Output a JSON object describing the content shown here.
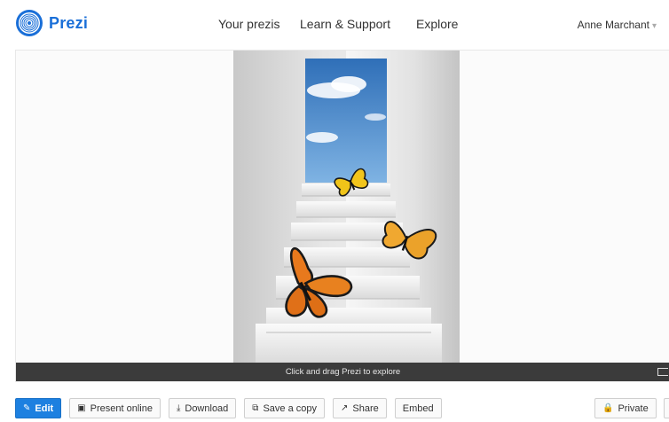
{
  "header": {
    "brand": "Prezi",
    "nav": [
      "Your prezis",
      "Learn & Support",
      "Explore"
    ],
    "user": "Anne Marchant"
  },
  "stage": {
    "hint": "Click and drag Prezi to explore"
  },
  "toolbar": {
    "edit": "Edit",
    "present_online": "Present online",
    "download": "Download",
    "save_copy": "Save a copy",
    "share": "Share",
    "embed": "Embed",
    "private": "Private"
  },
  "colors": {
    "brand": "#1a6fd8",
    "edit_button": "#1d80e0",
    "bar": "#3b3b3b",
    "sky": "#5a9bd5",
    "butterfly_orange": "#e8791d",
    "butterfly_yellow": "#f0c419"
  },
  "icons": [
    "prezi-logo-icon",
    "caret-down-icon",
    "pencil-icon",
    "presentation-icon",
    "download-icon",
    "copy-icon",
    "share-icon",
    "lock-icon",
    "trash-icon",
    "fullscreen-icon"
  ]
}
